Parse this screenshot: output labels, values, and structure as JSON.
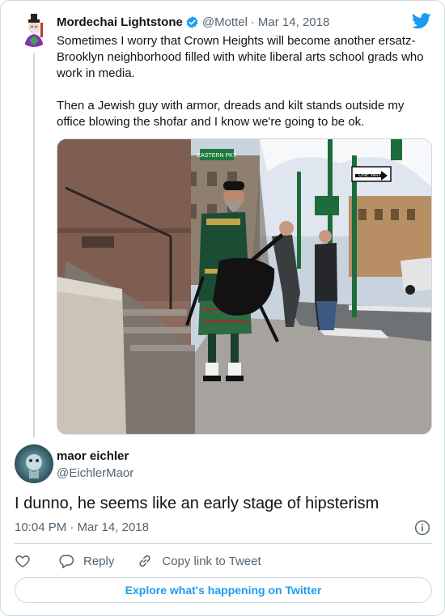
{
  "quoted_tweet": {
    "author_name": "Mordechai Lightstone",
    "handle": "@Mottel",
    "separator": "·",
    "date": "Mar 14, 2018",
    "text": "Sometimes I worry that Crown Heights will become another ersatz-Brooklyn neighborhood filled with white liberal arts school grads who work in media.\n\nThen a Jewish guy with armor, dreads and kilt stands outside my office blowing the shofar and I know we're going to be ok."
  },
  "photo": {
    "signs": [
      "EASTERN PKY",
      "ONE WAY"
    ]
  },
  "main_tweet": {
    "author_name": "maor eichler",
    "handle": "@EichlerMaor",
    "text": "I dunno, he seems like an early stage of hipsterism",
    "timestamp": "10:04 PM · Mar 14, 2018"
  },
  "actions": {
    "reply_label": "Reply",
    "copy_label": "Copy link to Tweet"
  },
  "explore_label": "Explore what's happening on Twitter",
  "colors": {
    "accent": "#1d9bf0",
    "text": "#0f1419",
    "muted": "#536471",
    "border": "#cfd9de"
  },
  "icons": [
    "twitter-logo-icon",
    "verified-badge-icon",
    "info-icon",
    "heart-icon",
    "reply-icon",
    "link-icon"
  ]
}
